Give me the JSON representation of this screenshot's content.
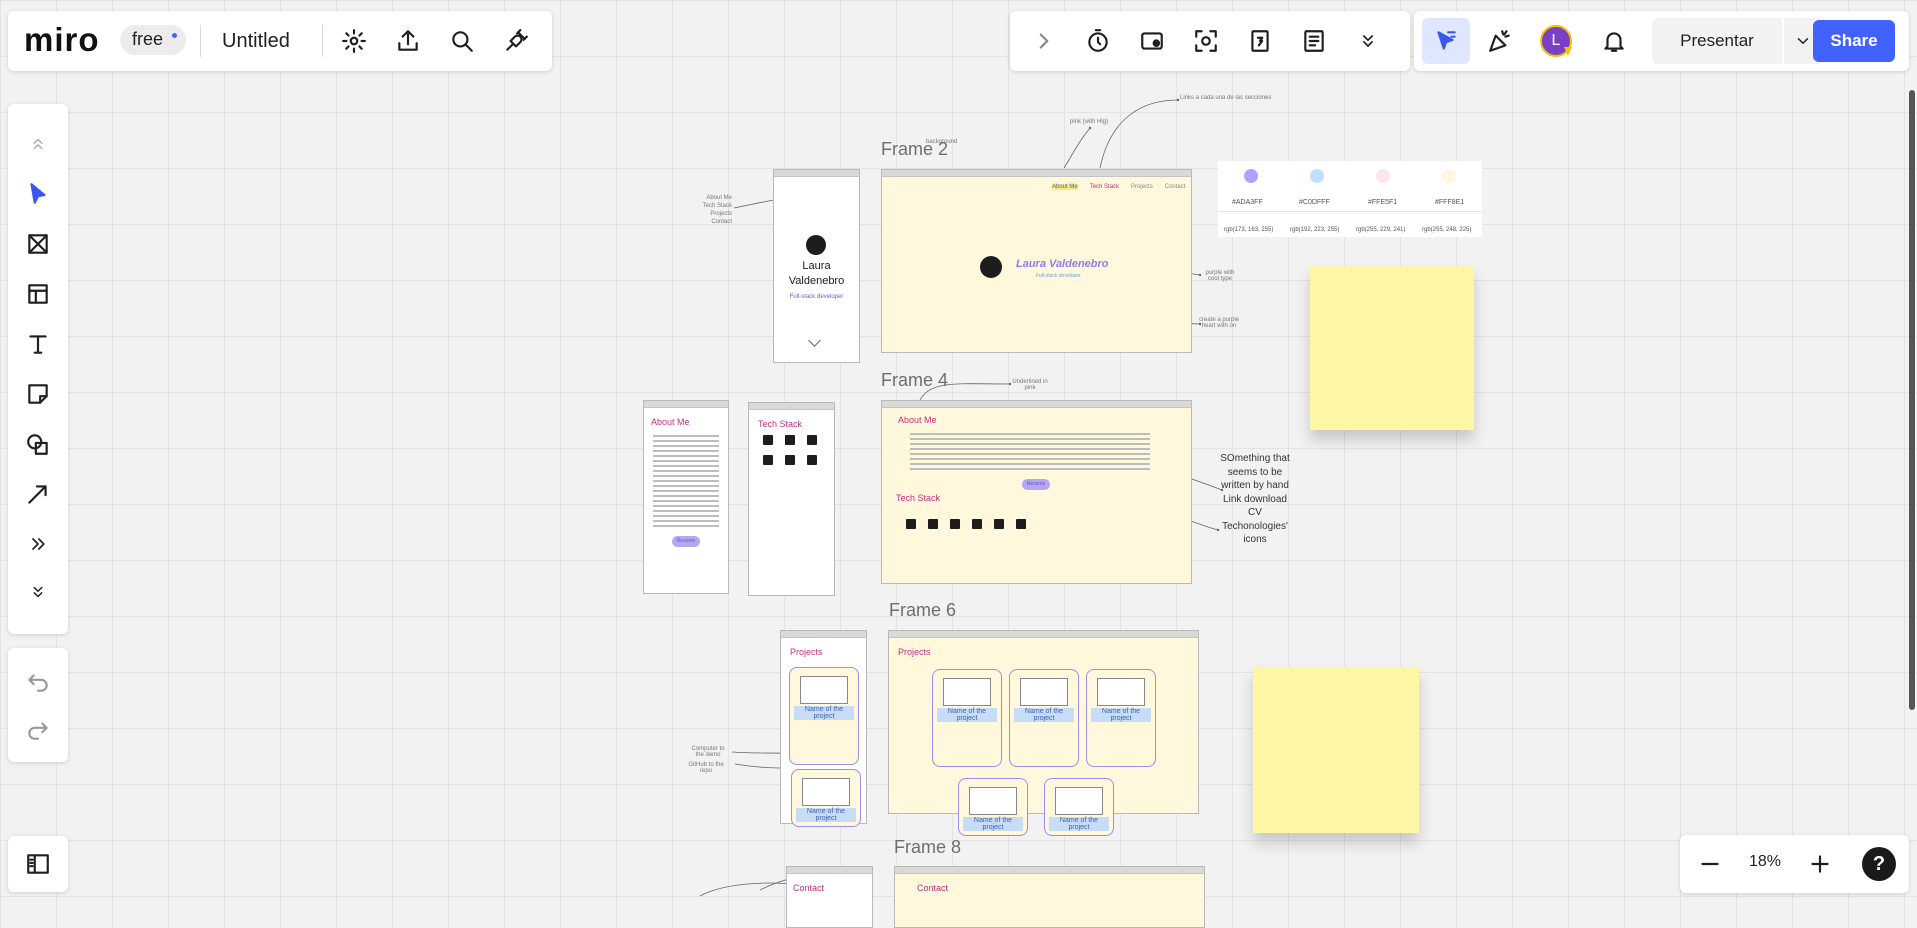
{
  "app": {
    "logo": "miro",
    "plan_badge": "free",
    "board_title": "Untitled"
  },
  "topbar_icons": [
    "settings-icon",
    "export-icon",
    "search-icon",
    "integrations-icon"
  ],
  "toolbar_center_icons": [
    "chevron-right-icon",
    "timer-icon",
    "voting-icon",
    "focus-icon",
    "card-icon",
    "notes-icon",
    "more-chevron-icon"
  ],
  "toolbar_right": {
    "avatar_initial": "L",
    "present_label": "Presentar",
    "share_label": "Share"
  },
  "left_tools": [
    "collapse-icon",
    "select-icon",
    "frame-icon",
    "templates-icon",
    "text-icon",
    "sticky-note-icon",
    "shapes-icon",
    "arrow-icon",
    "more-tools-icon",
    "expand-icon"
  ],
  "zoom": {
    "level": "18%"
  },
  "help": "?",
  "colors": {
    "accent": "#4262ff",
    "frame_bg": "#fff8dc",
    "sticky": "#fdf7a5",
    "pink": "#c5307a",
    "purple": "#ada3ff"
  },
  "canvas": {
    "frames": {
      "frame2": "Frame 2",
      "frame4": "Frame 4",
      "frame6": "Frame 6",
      "frame8": "Frame 8"
    },
    "hero": {
      "name_line1": "Laura",
      "name_line2": "Valdenebro",
      "role": "Full-stack developer",
      "big_name": "Laura Valdenebro",
      "nav": [
        "About Me",
        "Tech Stack",
        "Projects",
        "Contact"
      ]
    },
    "sections": {
      "about": "About Me",
      "tech": "Tech Stack",
      "projects": "Projects",
      "contact": "Contact",
      "project_name": "Name of the project",
      "resume": "Resume"
    },
    "mobile_nav": [
      "About Me",
      "Tech Stack",
      "Projects",
      "Contact"
    ],
    "palette": [
      {
        "hex": "#ADA3FF",
        "rgb": "rgb(173, 163, 255)",
        "color": "#ada3ff"
      },
      {
        "hex": "#C0DFFF",
        "rgb": "rgb(192, 223, 255)",
        "color": "#c0dfff"
      },
      {
        "hex": "#FFE5F1",
        "rgb": "rgb(255, 229, 241)",
        "color": "#ffe5f1"
      },
      {
        "hex": "#FFF8E1",
        "rgb": "rgb(255, 248, 225)",
        "color": "#fff8e1"
      }
    ],
    "annotations": {
      "links_each": "Links a cada una de las secciones",
      "pink_hl": "pink (with Hlg)",
      "background": "background",
      "purple_cool": "purple with cool type",
      "purple_heart": "create a purple heart with on",
      "underlined": "Underlined in pink",
      "handwritten": [
        "SOmething that",
        "seems to be",
        "written by hand",
        "Link download",
        "CV",
        "Techonologies'",
        "icons"
      ],
      "computer": "Computer to the demo",
      "github": "GitHub to the repo"
    }
  }
}
